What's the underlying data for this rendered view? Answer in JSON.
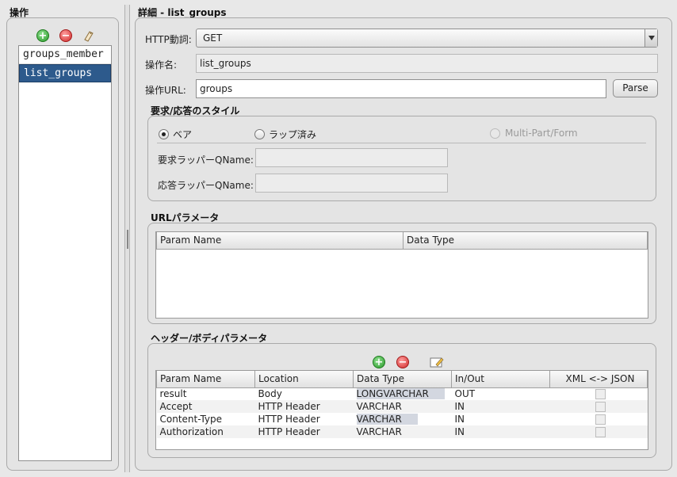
{
  "left": {
    "title": "操作",
    "toolbar": {
      "add_icon": "add-icon",
      "remove_icon": "remove-icon",
      "tag_icon": "tag-icon"
    },
    "items": [
      "groups_member",
      "list_groups"
    ],
    "selected_index": 1
  },
  "detail": {
    "title": "詳細 - list_groups",
    "http_method_label": "HTTP動詞:",
    "http_method_value": "GET",
    "op_name_label": "操作名:",
    "op_name_value": "list_groups",
    "op_url_label": "操作URL:",
    "op_url_value": "groups",
    "parse_label": "Parse"
  },
  "style_section": {
    "title": "要求/応答のスタイル",
    "radio_bare": "ベア",
    "radio_wrapped": "ラップ済み",
    "radio_multipart": "Multi-Part/Form",
    "selected": "bare",
    "req_wrapper_label": "要求ラッパーQName:",
    "resp_wrapper_label": "応答ラッパーQName:",
    "req_wrapper_value": "",
    "resp_wrapper_value": ""
  },
  "url_params": {
    "title": "URLパラメータ",
    "columns": [
      "Param Name",
      "Data Type"
    ],
    "rows": []
  },
  "header_body_params": {
    "title": "ヘッダー/ボディパラメータ",
    "columns": [
      "Param Name",
      "Location",
      "Data Type",
      "In/Out",
      "XML <-> JSON"
    ],
    "rows": [
      {
        "name": "result",
        "location": "Body",
        "type": "LONGVARCHAR",
        "inout": "OUT"
      },
      {
        "name": "Accept",
        "location": "HTTP Header",
        "type": "VARCHAR",
        "inout": "IN"
      },
      {
        "name": "Content-Type",
        "location": "HTTP Header",
        "type": "VARCHAR",
        "inout": "IN"
      },
      {
        "name": "Authorization",
        "location": "HTTP Header",
        "type": "VARCHAR",
        "inout": "IN"
      }
    ]
  }
}
